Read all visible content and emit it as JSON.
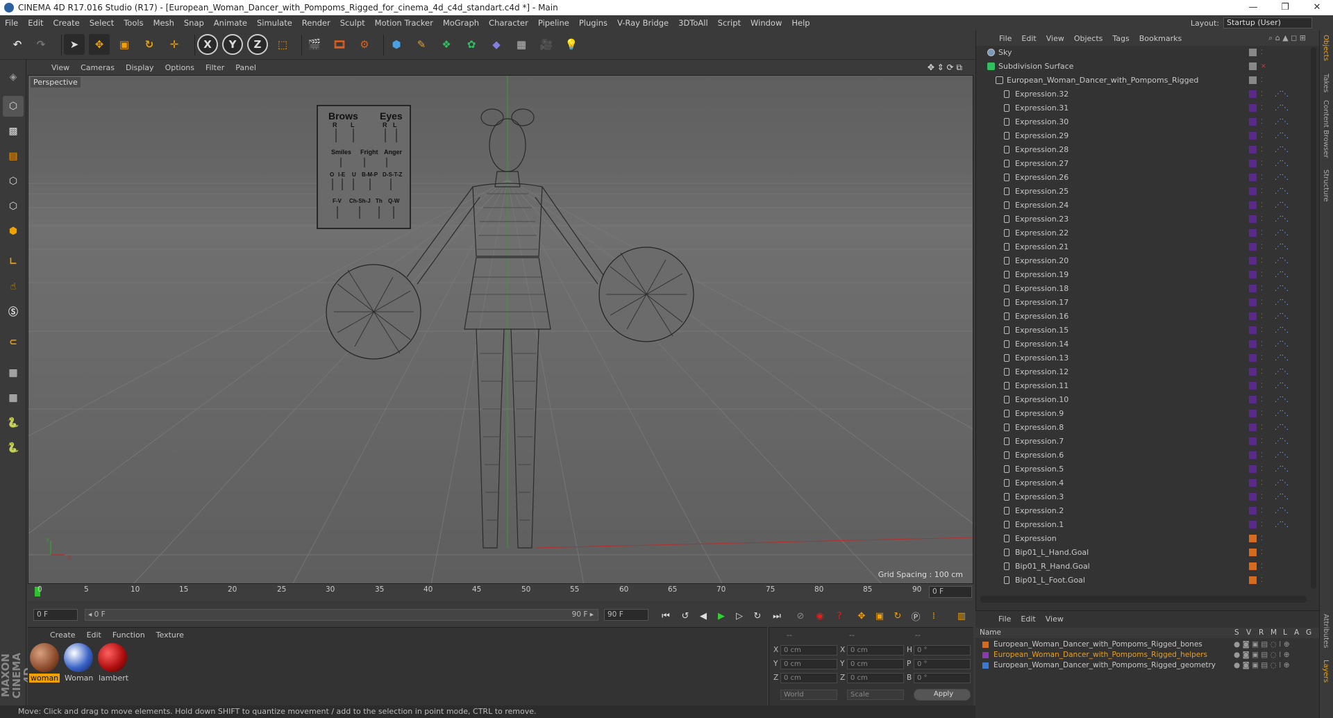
{
  "window": {
    "title": "CINEMA 4D R17.016 Studio (R17) - [European_Woman_Dancer_with_Pompoms_Rigged_for_cinema_4d_c4d_standart.c4d *] - Main",
    "minimize": "—",
    "maximize": "❐",
    "close": "✕"
  },
  "menu": [
    "File",
    "Edit",
    "Create",
    "Select",
    "Tools",
    "Mesh",
    "Snap",
    "Animate",
    "Simulate",
    "Render",
    "Sculpt",
    "Motion Tracker",
    "MoGraph",
    "Character",
    "Pipeline",
    "Plugins",
    "V-Ray Bridge",
    "3DToAll",
    "Script",
    "Window",
    "Help"
  ],
  "layout": {
    "label": "Layout:",
    "value": "Startup (User)"
  },
  "toolbar": {
    "undo": "↶",
    "redo": "↷",
    "x_axis": "X",
    "y_axis": "Y",
    "z_axis": "Z"
  },
  "viewport": {
    "menu": [
      "View",
      "Cameras",
      "Display",
      "Options",
      "Filter",
      "Panel"
    ],
    "camera": "Perspective",
    "grid_spacing": "Grid Spacing : 100 cm",
    "axis_y": "Y",
    "axis_x": "X",
    "rig_board": {
      "brows": "Brows",
      "eyes": "Eyes",
      "r1": "R",
      "l1": "L",
      "r2": "R",
      "l2": "L",
      "smiles": "Smiles",
      "fright": "Fright",
      "anger": "Anger",
      "o": "O",
      "ie": "I-E",
      "u": "U",
      "bmp": "B-M-P",
      "dstz": "D-S-T-Z",
      "fv": "F-V",
      "chshj": "Ch-Sh-J",
      "th": "Th",
      "qw": "Q-W"
    }
  },
  "timeline": {
    "ticks": [
      "0",
      "5",
      "10",
      "15",
      "20",
      "25",
      "30",
      "35",
      "40",
      "45",
      "50",
      "55",
      "60",
      "65",
      "70",
      "75",
      "80",
      "85",
      "90"
    ],
    "current_frame": "0 F"
  },
  "playback": {
    "start": "0 F",
    "range_start": "◂ 0 F",
    "range_end": "90 F ▸",
    "end": "90 F"
  },
  "materials": {
    "menu": [
      "Create",
      "Edit",
      "Function",
      "Texture"
    ],
    "items": [
      {
        "name": "woman",
        "color": "#8a4a2a"
      },
      {
        "name": "Woman",
        "color": "#3a64c8"
      },
      {
        "name": "lambert",
        "color": "#b01010"
      }
    ]
  },
  "coords": {
    "header": [
      "--",
      "--",
      "--"
    ],
    "rows": [
      {
        "a": "X",
        "av": "0 cm",
        "b": "X",
        "bv": "0 cm",
        "c": "H",
        "cv": "0 °"
      },
      {
        "a": "Y",
        "av": "0 cm",
        "b": "Y",
        "bv": "0 cm",
        "c": "P",
        "cv": "0 °"
      },
      {
        "a": "Z",
        "av": "0 cm",
        "b": "Z",
        "bv": "0 cm",
        "c": "B",
        "cv": "0 °"
      }
    ],
    "world": "World",
    "scale": "Scale",
    "apply": "Apply"
  },
  "status": "Move: Click and drag to move elements. Hold down SHIFT to quantize movement / add to the selection in point mode, CTRL to remove.",
  "maxon": "MAXON CINEMA 4D",
  "objects": {
    "menu": [
      "File",
      "Edit",
      "View",
      "Objects",
      "Tags",
      "Bookmarks"
    ],
    "items": [
      {
        "name": "Sky",
        "level": 0
      },
      {
        "name": "Subdivision Surface",
        "level": 0
      },
      {
        "name": "European_Woman_Dancer_with_Pompoms_Rigged",
        "level": 1
      },
      {
        "name": "Expression.32",
        "level": 2
      },
      {
        "name": "Expression.31",
        "level": 2
      },
      {
        "name": "Expression.30",
        "level": 2
      },
      {
        "name": "Expression.29",
        "level": 2
      },
      {
        "name": "Expression.28",
        "level": 2
      },
      {
        "name": "Expression.27",
        "level": 2
      },
      {
        "name": "Expression.26",
        "level": 2
      },
      {
        "name": "Expression.25",
        "level": 2
      },
      {
        "name": "Expression.24",
        "level": 2
      },
      {
        "name": "Expression.23",
        "level": 2
      },
      {
        "name": "Expression.22",
        "level": 2
      },
      {
        "name": "Expression.21",
        "level": 2
      },
      {
        "name": "Expression.20",
        "level": 2
      },
      {
        "name": "Expression.19",
        "level": 2
      },
      {
        "name": "Expression.18",
        "level": 2
      },
      {
        "name": "Expression.17",
        "level": 2
      },
      {
        "name": "Expression.16",
        "level": 2
      },
      {
        "name": "Expression.15",
        "level": 2
      },
      {
        "name": "Expression.14",
        "level": 2
      },
      {
        "name": "Expression.13",
        "level": 2
      },
      {
        "name": "Expression.12",
        "level": 2
      },
      {
        "name": "Expression.11",
        "level": 2
      },
      {
        "name": "Expression.10",
        "level": 2
      },
      {
        "name": "Expression.9",
        "level": 2
      },
      {
        "name": "Expression.8",
        "level": 2
      },
      {
        "name": "Expression.7",
        "level": 2
      },
      {
        "name": "Expression.6",
        "level": 2
      },
      {
        "name": "Expression.5",
        "level": 2
      },
      {
        "name": "Expression.4",
        "level": 2
      },
      {
        "name": "Expression.3",
        "level": 2
      },
      {
        "name": "Expression.2",
        "level": 2
      },
      {
        "name": "Expression.1",
        "level": 2
      },
      {
        "name": "Expression",
        "level": 2
      },
      {
        "name": "Bip01_L_Hand.Goal",
        "level": 2
      },
      {
        "name": "Bip01_R_Hand.Goal",
        "level": 2
      },
      {
        "name": "Bip01_L_Foot.Goal",
        "level": 2
      }
    ]
  },
  "layers": {
    "menu": [
      "File",
      "Edit",
      "View"
    ],
    "columns": [
      "Name",
      "S",
      "V",
      "R",
      "M",
      "L",
      "A",
      "G"
    ],
    "items": [
      {
        "name": "European_Woman_Dancer_with_Pompoms_Rigged_bones",
        "color": "#d86a1e",
        "text_color": "#c8c8c8"
      },
      {
        "name": "European_Woman_Dancer_with_Pompoms_Rigged_helpers",
        "color": "#8a3ab0",
        "text_color": "#e8a020"
      },
      {
        "name": "European_Woman_Dancer_with_Pompoms_Rigged_geometry",
        "color": "#3a7ad0",
        "text_color": "#c8c8c8"
      }
    ]
  },
  "side_tabs": [
    "Objects",
    "Takes",
    "Content Browser",
    "Structure",
    "Attributes",
    "Layers"
  ]
}
